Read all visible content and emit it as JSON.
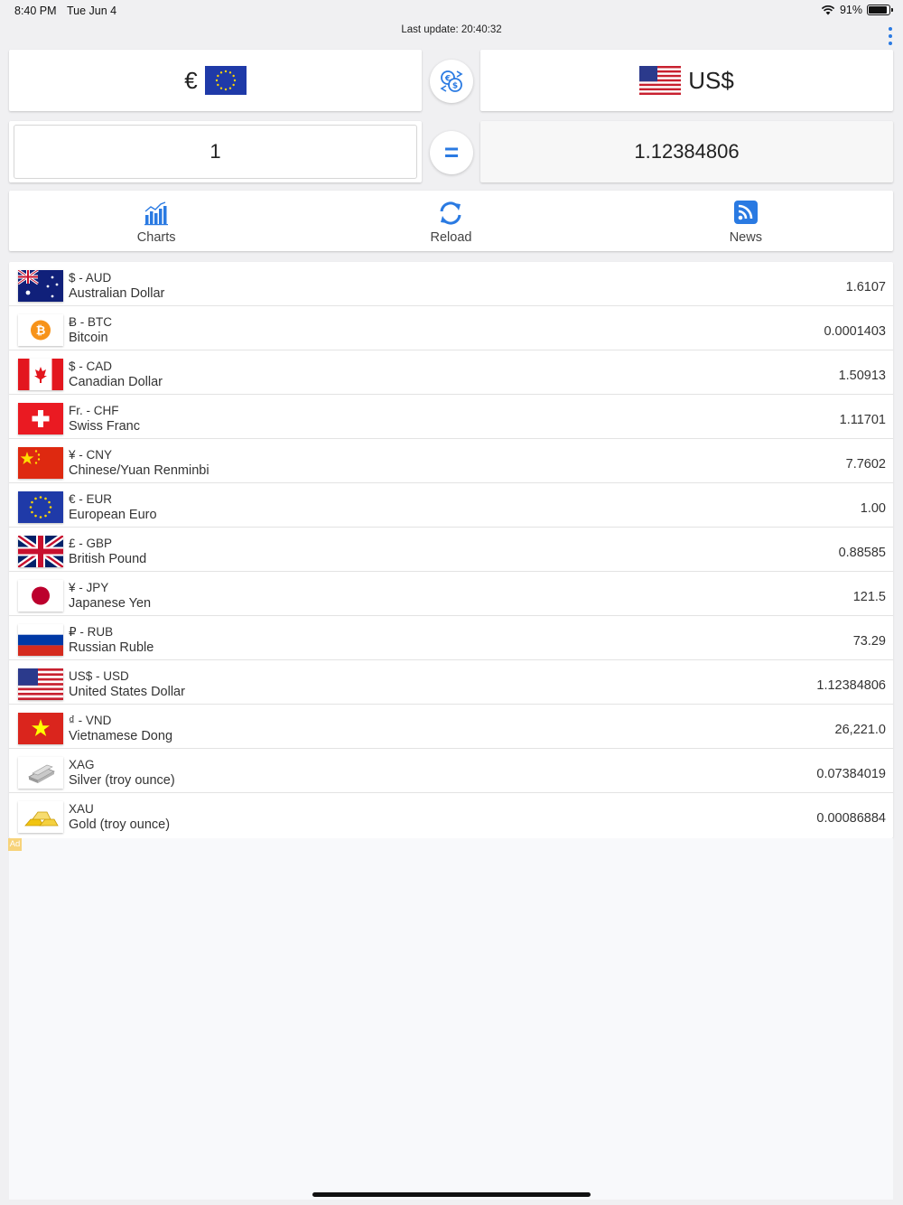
{
  "status": {
    "time": "8:40 PM",
    "date": "Tue Jun 4",
    "battery": "91%",
    "battery_level": 0.91
  },
  "header": {
    "last_update": "Last update: 20:40:32"
  },
  "converter": {
    "from_symbol": "€",
    "from_flag": "eu",
    "to_symbol": "US$",
    "to_flag": "us",
    "amount": "1",
    "result": "1.12384806"
  },
  "toolbar": [
    {
      "id": "charts",
      "label": "Charts",
      "icon": "chart-icon"
    },
    {
      "id": "reload",
      "label": "Reload",
      "icon": "reload-icon"
    },
    {
      "id": "news",
      "label": "News",
      "icon": "rss-icon"
    }
  ],
  "currencies": [
    {
      "code": "$ - AUD",
      "name": "Australian Dollar",
      "rate": "1.6107",
      "flag": "au"
    },
    {
      "code": "Ƀ - BTC",
      "name": "Bitcoin",
      "rate": "0.0001403",
      "flag": "btc"
    },
    {
      "code": "$ - CAD",
      "name": "Canadian Dollar",
      "rate": "1.50913",
      "flag": "ca"
    },
    {
      "code": "Fr. - CHF",
      "name": "Swiss Franc",
      "rate": "1.11701",
      "flag": "ch"
    },
    {
      "code": "¥ - CNY",
      "name": "Chinese/Yuan Renminbi",
      "rate": "7.7602",
      "flag": "cn"
    },
    {
      "code": "€ - EUR",
      "name": "European Euro",
      "rate": "1.00",
      "flag": "eu"
    },
    {
      "code": "£ - GBP",
      "name": "British Pound",
      "rate": "0.88585",
      "flag": "gb"
    },
    {
      "code": "¥ - JPY",
      "name": "Japanese Yen",
      "rate": "121.5",
      "flag": "jp"
    },
    {
      "code": "₽ - RUB",
      "name": "Russian Ruble",
      "rate": "73.29",
      "flag": "ru"
    },
    {
      "code": "US$ - USD",
      "name": "United States Dollar",
      "rate": "1.12384806",
      "flag": "us"
    },
    {
      "code": "₫ - VND",
      "name": "Vietnamese Dong",
      "rate": "26,221.0",
      "flag": "vn"
    },
    {
      "code": "XAG",
      "name": "Silver (troy ounce)",
      "rate": "0.07384019",
      "flag": "xag"
    },
    {
      "code": "XAU",
      "name": "Gold (troy ounce)",
      "rate": "0.00086884",
      "flag": "xau"
    }
  ],
  "ad": {
    "label": "Ad"
  },
  "colors": {
    "accent": "#2a7ae2",
    "background": "#f0f0f2"
  }
}
